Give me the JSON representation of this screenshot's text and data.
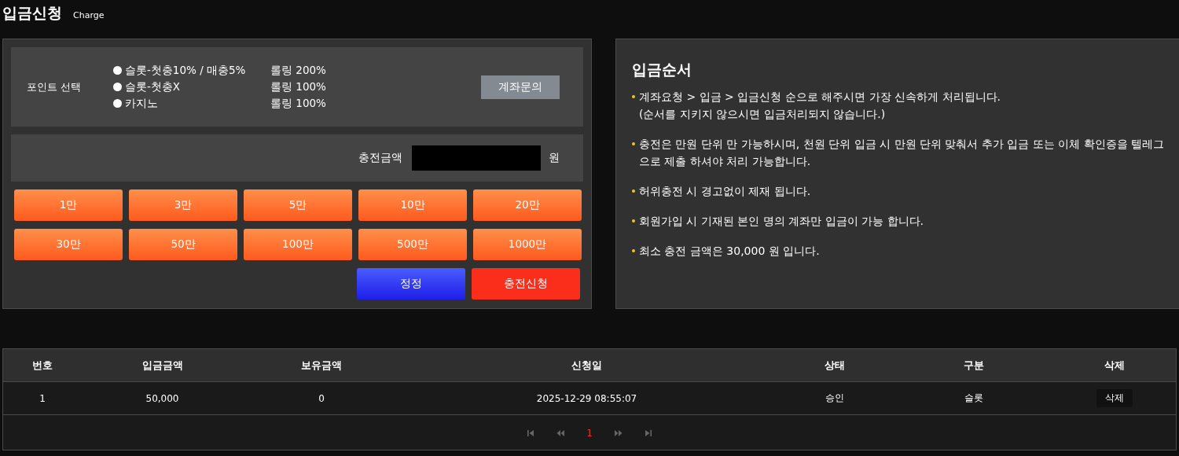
{
  "header": {
    "title": "입금신청",
    "subtitle": "Charge"
  },
  "point_select": {
    "label": "포인트 선택",
    "options": [
      {
        "label": "슬롯-첫충10% / 매충5%",
        "rolling": "롤링 200%",
        "selected": false
      },
      {
        "label": "슬롯-첫충X",
        "rolling": "롤링 100%",
        "selected": false
      },
      {
        "label": "카지노",
        "rolling": "롤링 100%",
        "selected": false
      }
    ],
    "account_button": "계좌문의"
  },
  "amount": {
    "label": "충전금액",
    "unit": "원"
  },
  "amount_buttons": [
    "1만",
    "3만",
    "5만",
    "10만",
    "20만",
    "30만",
    "50만",
    "100만",
    "500만",
    "1000만"
  ],
  "actions": [
    {
      "label": "정정",
      "kind": "reset"
    },
    {
      "label": "충전신청",
      "kind": "submit"
    }
  ],
  "guide": {
    "title": "입금순서",
    "items": [
      {
        "lines": [
          "계좌요청 > 입금 > 입금신청 순으로 해주시면 가장 신속하게 처리됩니다.",
          "(순서를 지키지 않으시면 입금처리되지 않습니다.)"
        ]
      },
      {
        "lines": [
          "충전은 만원 단위 만 가능하시며, 천원 단위 입금 시 만원 단위 맞춰서 추가 입금 또는 이체 확인증을 텔레그",
          "으로 제출 하셔야 처리 가능합니다."
        ]
      },
      {
        "lines": [
          "허위충전 시 경고없이 제재 됩니다."
        ]
      },
      {
        "lines": [
          "회원가입 시 기재된 본인 명의 계좌만 입금이 가능 합니다."
        ]
      },
      {
        "lines": [
          "최소 충전 금액은 30,000 원 입니다."
        ]
      }
    ]
  },
  "table": {
    "columns": [
      "번호",
      "입금금액",
      "보유금액",
      "신청일",
      "상태",
      "구분",
      "삭제"
    ],
    "rows": [
      {
        "cells": [
          "1",
          "50,000",
          "0",
          "2025-12-29 08:55:07",
          "승인",
          "슬롯"
        ],
        "delete": "삭제"
      }
    ]
  },
  "pagination": {
    "pages": [
      {
        "label": "1",
        "selected": true
      }
    ]
  }
}
